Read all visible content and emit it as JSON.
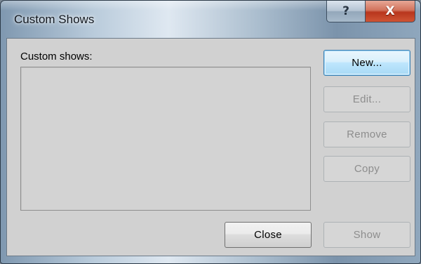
{
  "window": {
    "title": "Custom Shows"
  },
  "caption_buttons": {
    "help_glyph": "?",
    "close_glyph": "X",
    "help_icon": "help-question-icon",
    "close_icon": "close-x-icon"
  },
  "list": {
    "label": "Custom shows:",
    "items": []
  },
  "buttons": {
    "new": {
      "label": "New...",
      "enabled": true,
      "default": true
    },
    "edit": {
      "label": "Edit...",
      "enabled": false
    },
    "remove": {
      "label": "Remove",
      "enabled": false
    },
    "copy": {
      "label": "Copy",
      "enabled": false
    },
    "close": {
      "label": "Close",
      "enabled": true
    },
    "show": {
      "label": "Show",
      "enabled": false
    }
  },
  "colors": {
    "close_button_red": "#c8452a",
    "dialog_background": "#d1d1d1",
    "default_button_blue": "#3c7fb1",
    "disabled_text": "#8d8d8d"
  }
}
